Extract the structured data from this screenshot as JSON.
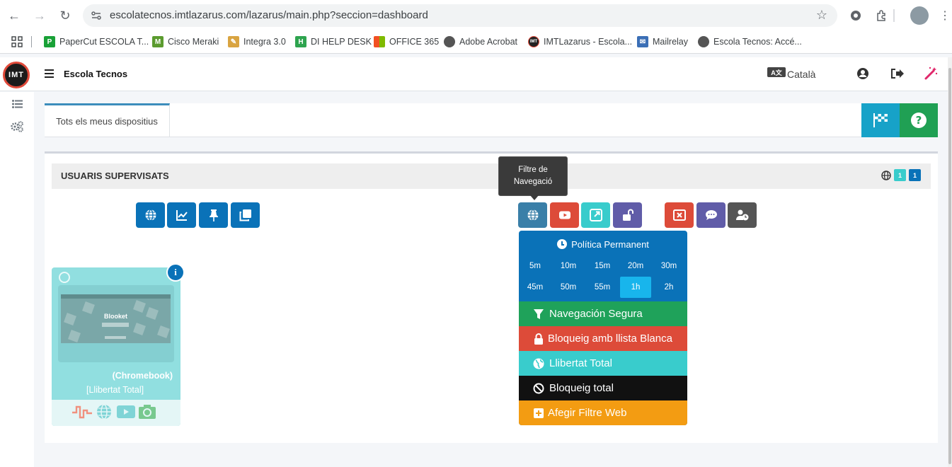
{
  "browser": {
    "url": "escolatecnos.imtlazarus.com/lazarus/main.php?seccion=dashboard",
    "bookmarks": [
      {
        "label": "PaperCut ESCOLA T...",
        "icon": "papercut-icon",
        "color": "#19a137"
      },
      {
        "label": "Cisco Meraki",
        "icon": "meraki-icon",
        "color": "#5b9b2f"
      },
      {
        "label": "Integra 3.0",
        "icon": "integra-icon",
        "color": "#d9a441"
      },
      {
        "label": "DI HELP DESK",
        "icon": "helpdesk-icon",
        "color": "#2ea44f"
      },
      {
        "label": "OFFICE 365",
        "icon": "office-icon",
        "color": "#f25022"
      },
      {
        "label": "Adobe Acrobat",
        "icon": "globe-icon",
        "color": "#555555"
      },
      {
        "label": "IMTLazarus - Escola...",
        "icon": "imt-icon",
        "color": "#222222"
      },
      {
        "label": "Mailrelay",
        "icon": "mail-icon",
        "color": "#3b6fb6"
      },
      {
        "label": "Escola Tecnos: Accé...",
        "icon": "globe-icon",
        "color": "#555555"
      }
    ]
  },
  "header": {
    "logo_text": "IMT",
    "brand": "Escola Tecnos",
    "language": "Català"
  },
  "tabs": {
    "active_label": "Tots els meus dispositius"
  },
  "card": {
    "title": "USUARIS SUPERVISATS",
    "badge_online": "1",
    "badge_total": "1"
  },
  "tooltip": {
    "line1": "Filtre de",
    "line2": "Navegació"
  },
  "dropdown": {
    "heading": "Política Permanent",
    "times": [
      "5m",
      "10m",
      "15m",
      "20m",
      "30m",
      "45m",
      "50m",
      "55m",
      "1h",
      "2h"
    ],
    "active_time": "1h",
    "options": [
      {
        "label": "Navegación Segura",
        "color": "#1fa25a",
        "icon": "filter-icon"
      },
      {
        "label": "Bloqueig amb llista Blanca",
        "color": "#dd4b39",
        "icon": "lock-icon"
      },
      {
        "label": "Llibertat Total",
        "color": "#39cccc",
        "icon": "globe-icon"
      },
      {
        "label": "Bloqueig total",
        "color": "#111111",
        "icon": "ban-icon"
      },
      {
        "label": "Afegir Filtre Web",
        "color": "#f39c12",
        "icon": "plus-square-icon"
      }
    ]
  },
  "device": {
    "screen_title": "Blooket",
    "type": "(Chromebook)",
    "status": "[Llibertat Total]"
  },
  "colors": {
    "primary": "#0a72b8",
    "danger": "#dd4b39",
    "info": "#39cccc",
    "purple": "#605ca8",
    "gray": "#555555"
  }
}
